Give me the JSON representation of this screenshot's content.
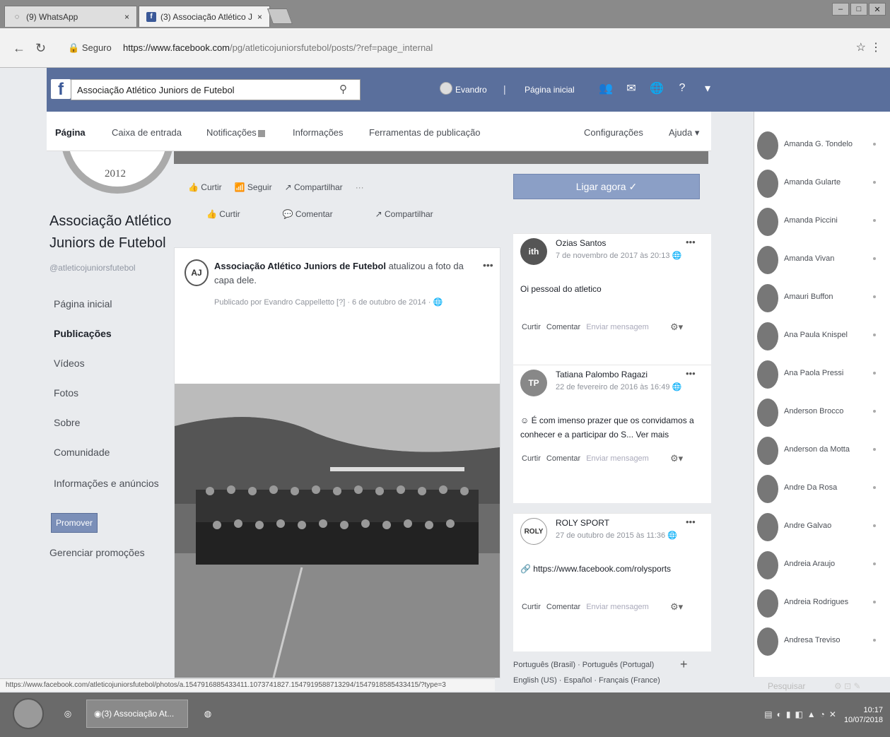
{
  "browser": {
    "tabs": [
      {
        "label": "(9) WhatsApp",
        "close": "×"
      },
      {
        "label": "(3) Associação Atlético J",
        "close": "×"
      }
    ],
    "secure_label": "Seguro",
    "url_host": "https://www.facebook.com",
    "url_path": "/pg/atleticojuniorsfutebol/posts/?ref=page_internal",
    "status_url": "https://www.facebook.com/atleticojuniorsfutebol/photos/a.1547916885433411.1073741827.1547919588713294/1547918585433415/?type=3"
  },
  "fb": {
    "search_value": "Associação Atlético Juniors de Futebol",
    "user_name": "Evandro",
    "home_label": "Página inicial"
  },
  "pagenav": {
    "items": [
      "Página",
      "Caixa de entrada",
      "Notificações",
      "Informações",
      "Ferramentas de publicação"
    ],
    "settings": "Configurações",
    "help": "Ajuda ▾"
  },
  "page": {
    "year": "2012",
    "name": "Associação Atlético Juniors de Futebol",
    "handle": "@atleticojuniorsfutebol",
    "left_nav": [
      "Página inicial",
      "Publicações",
      "Vídeos",
      "Fotos",
      "Sobre",
      "Comunidade",
      "Informações e anúncios"
    ],
    "promote": "Promover",
    "manage_promotions": "Gerenciar promoções"
  },
  "actions": {
    "like": "Curtir",
    "follow": "Seguir",
    "share": "Compartilhar",
    "more": "···",
    "row2_like": "Curtir",
    "row2_comment": "Comentar",
    "row2_share": "Compartilhar"
  },
  "post": {
    "author": "Associação Atlético Juniors de Futebol",
    "action": "atualizou a foto da capa dele.",
    "meta": "Publicado por Evandro Cappelletto [?] · 6 de outubro de 2014 ·"
  },
  "call_button": "Ligar agora ✓",
  "visitor_posts": [
    {
      "name": "Ozias Santos",
      "date": "7 de novembro de 2017 às 20:13",
      "text": "Oi pessoal do atletico",
      "like": "Curtir",
      "comment": "Comentar",
      "send": "Enviar mensagem",
      "initials": "ith"
    },
    {
      "name": "Tatiana Palombo Ragazi",
      "date": "22 de fevereiro de 2016 às 16:49",
      "text": "☺ É com imenso prazer que os convidamos a conhecer e a participar do S... Ver mais",
      "like": "Curtir",
      "comment": "Comentar",
      "send": "Enviar mensagem",
      "initials": "TP"
    },
    {
      "name": "ROLY SPORT",
      "date": "27 de outubro de 2015 às 11:36",
      "text": "https://www.facebook.com/rolysports",
      "like": "Curtir",
      "comment": "Comentar",
      "send": "Enviar mensagem",
      "initials": "ROLY"
    }
  ],
  "languages": {
    "line1": "Português (Brasil) · Português (Portugal)",
    "line2": "English (US) · Español · Français (France)"
  },
  "contacts": [
    "Amanda G. Tondelo",
    "Amanda Gularte",
    "Amanda Piccini",
    "Amanda Vivan",
    "Amauri Buffon",
    "Ana Paula Knispel",
    "Ana Paola Pressi",
    "Anderson Brocco",
    "Anderson da Motta",
    "Andre Da Rosa",
    "Andre Galvao",
    "Andreia Araujo",
    "Andreia Rodrigues",
    "Andresa Treviso"
  ],
  "contacts_search": "Pesquisar",
  "taskbar": {
    "chrome_label": "(3) Associação At...",
    "time": "10:17",
    "date": "10/07/2018"
  }
}
